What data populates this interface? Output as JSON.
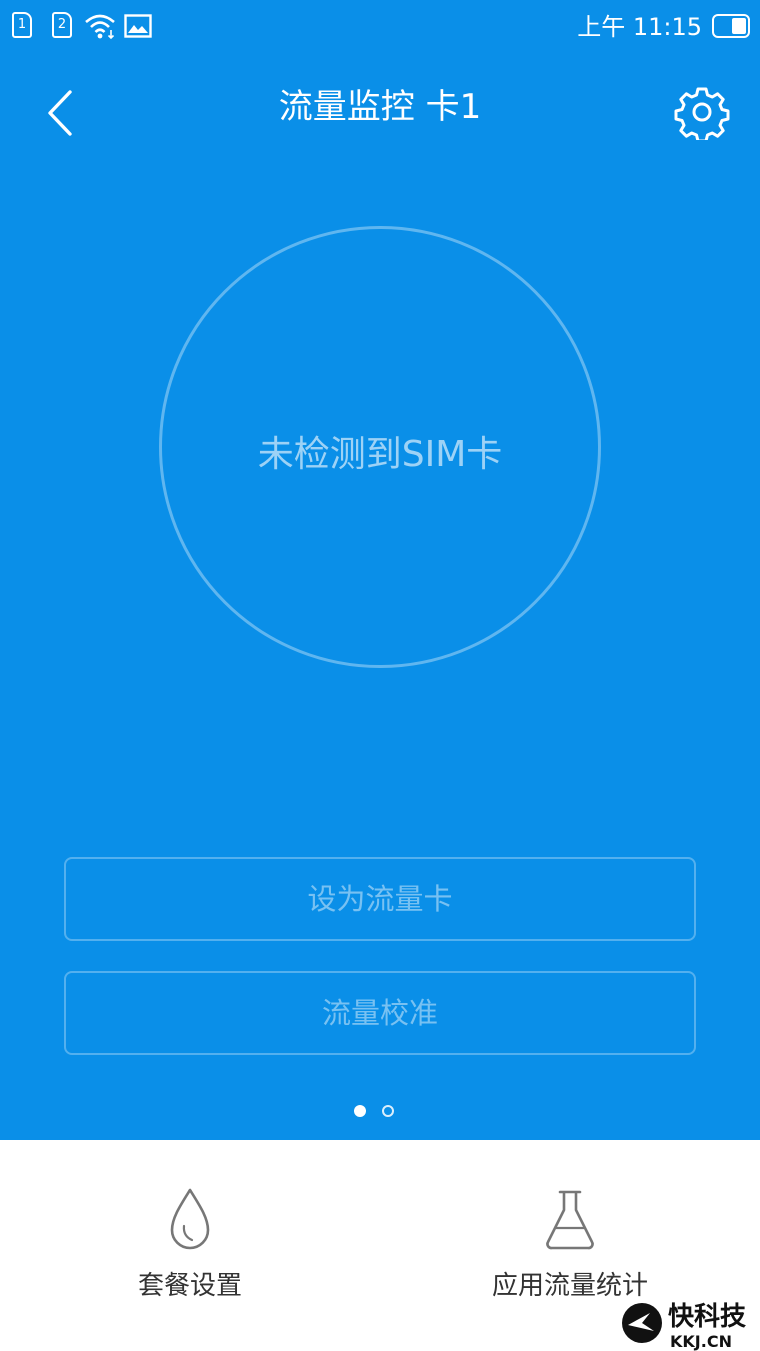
{
  "status_bar": {
    "sim1": "1",
    "sim2": "2",
    "time": "上午 11:15",
    "icons": [
      "sim1-icon",
      "sim2-icon",
      "wifi-icon",
      "image-icon",
      "battery-icon"
    ]
  },
  "header": {
    "title": "流量监控 卡1"
  },
  "main": {
    "circle_text": "未检测到SIM卡",
    "set_as_data_card": "设为流量卡",
    "data_calibration": "流量校准",
    "page_count": 2,
    "current_page": 1
  },
  "bottom_nav": [
    {
      "label": "套餐设置",
      "icon": "drop-icon"
    },
    {
      "label": "应用流量统计",
      "icon": "flask-icon"
    }
  ],
  "watermark": {
    "brand": "快科技",
    "site": "KKJ.CN"
  },
  "colors": {
    "primary": "#0a8fe8",
    "background": "#ffffff",
    "text_dark": "#333333"
  }
}
